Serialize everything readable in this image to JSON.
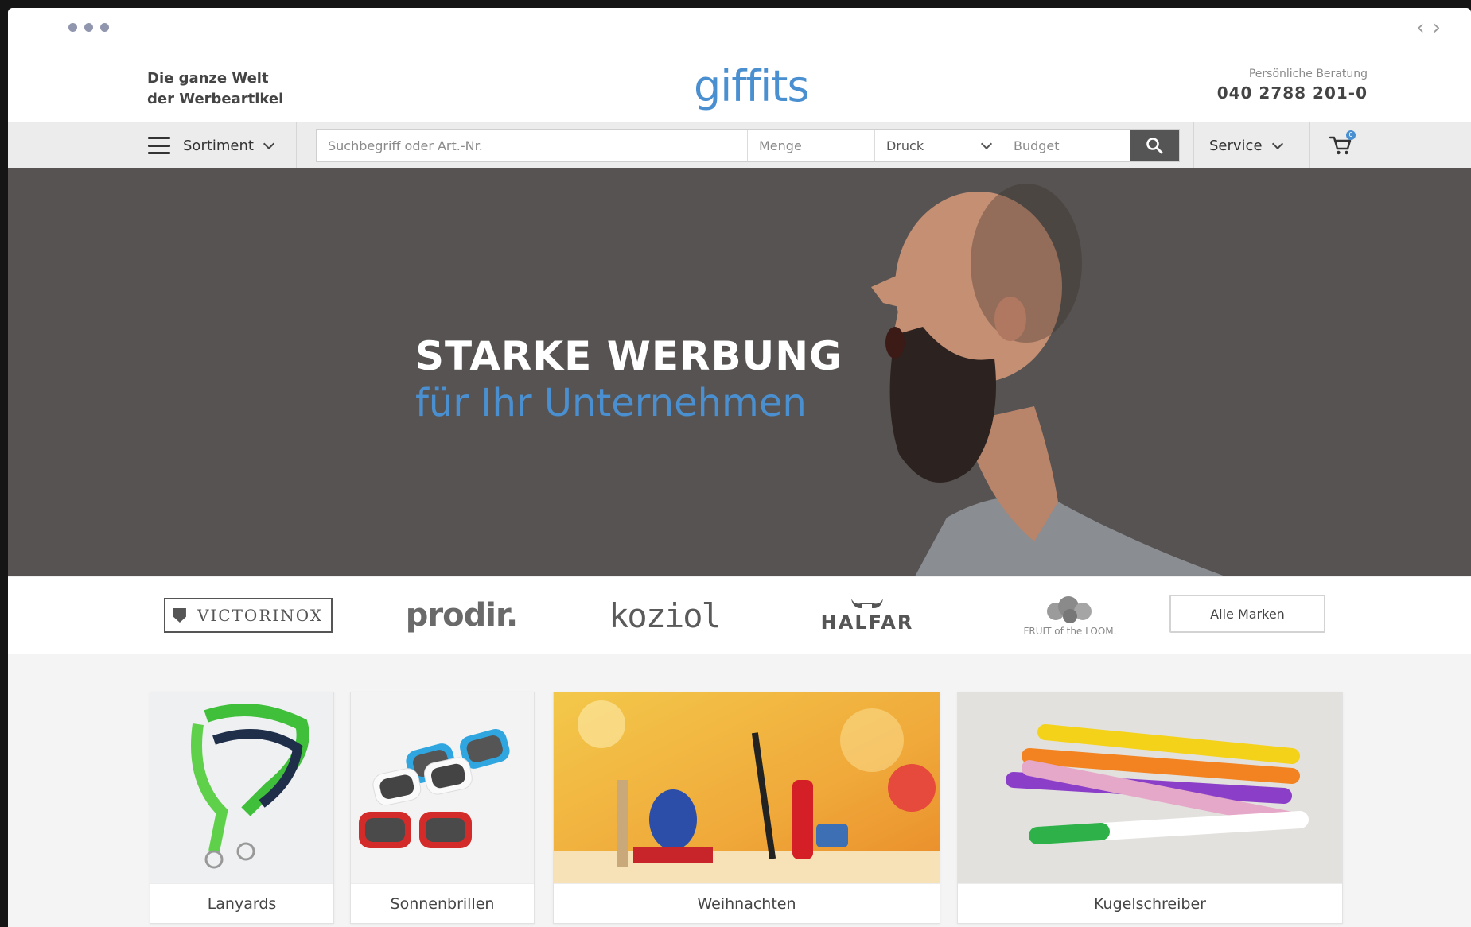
{
  "header": {
    "tagline_line1": "Die ganze Welt",
    "tagline_line2": "der Werbeartikel",
    "logo": "giffits",
    "contact_label": "Persönliche Beratung",
    "contact_phone": "040 2788 201-0"
  },
  "navbar": {
    "menu_label": "Sortiment",
    "search_placeholder": "Suchbegriff oder Art.-Nr.",
    "quantity_placeholder": "Menge",
    "print_label": "Druck",
    "budget_placeholder": "Budget",
    "service_label": "Service",
    "cart_count": "0"
  },
  "hero": {
    "title": "STARKE WERBUNG",
    "subtitle": "für Ihr Unternehmen"
  },
  "brands": {
    "items": [
      "VICTORINOX",
      "prodir.",
      "koziol",
      "HALFAR",
      "FRUIT of the LOOM."
    ],
    "all_label": "Alle Marken"
  },
  "categories": [
    {
      "label": "Lanyards"
    },
    {
      "label": "Sonnenbrillen"
    },
    {
      "label": "Weihnachten"
    },
    {
      "label": "Kugelschreiber"
    }
  ],
  "colors": {
    "brand_blue": "#4a8fd0",
    "hero_bg": "#575352",
    "nav_bg": "#ececec"
  }
}
